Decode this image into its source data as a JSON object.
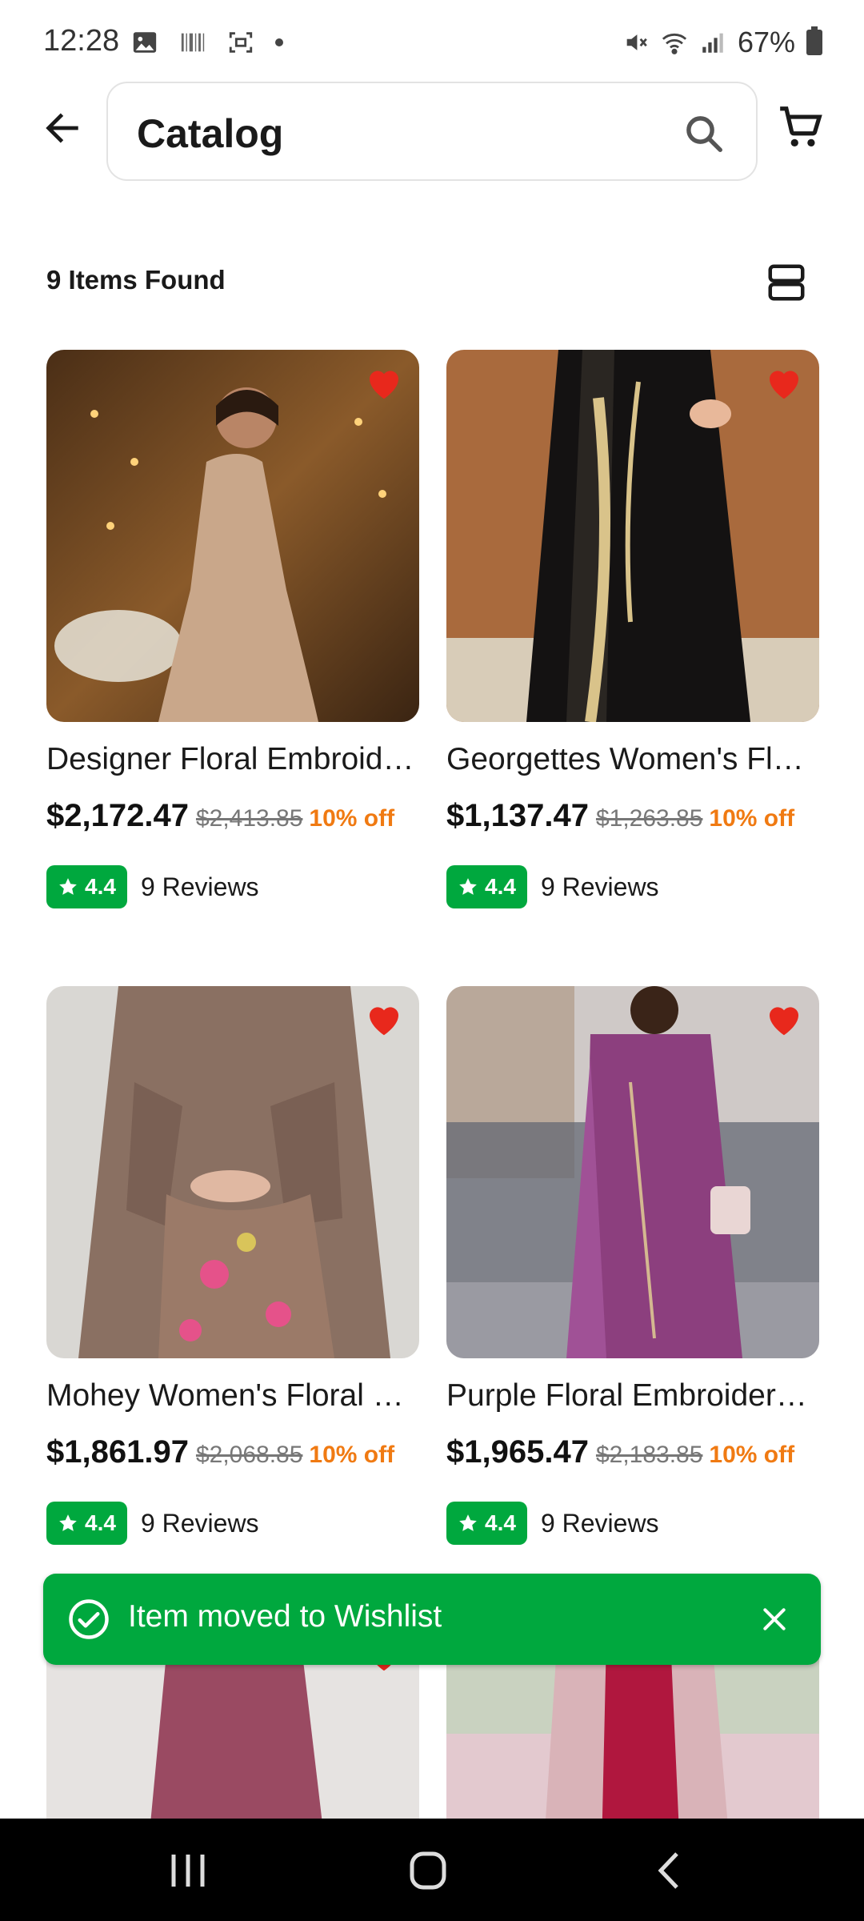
{
  "status_bar": {
    "time": "12:28",
    "battery": "67%",
    "icons": [
      "image-icon",
      "barcode-icon",
      "screenshot-icon",
      "dot-icon",
      "mute-icon",
      "wifi-icon",
      "signal-icon",
      "battery-icon"
    ]
  },
  "header": {
    "title": "Catalog",
    "back_icon": "arrow-left-icon",
    "search_icon": "search-icon",
    "cart_icon": "cart-icon"
  },
  "results": {
    "count_text": "9 Items Found",
    "view_toggle_icon": "view-list-icon"
  },
  "products": [
    {
      "name": "Designer Floral Embroidered Outfit",
      "price": "$2,172.47",
      "old_price": "$2,413.85",
      "discount": "10% off",
      "rating": "4.4",
      "reviews": "9 Reviews",
      "wishlisted": true
    },
    {
      "name": "Georgettes Women's Floral Dress",
      "price": "$1,137.47",
      "old_price": "$1,263.85",
      "discount": "10% off",
      "rating": "4.4",
      "reviews": "9 Reviews",
      "wishlisted": true
    },
    {
      "name": "Mohey Women's Floral Kurta",
      "price": "$1,861.97",
      "old_price": "$2,068.85",
      "discount": "10% off",
      "rating": "4.4",
      "reviews": "9 Reviews",
      "wishlisted": true
    },
    {
      "name": "Purple Floral Embroidered Suit",
      "price": "$1,965.47",
      "old_price": "$2,183.85",
      "discount": "10% off",
      "rating": "4.4",
      "reviews": "9 Reviews",
      "wishlisted": true
    }
  ],
  "toast": {
    "message": "Item moved to Wishlist",
    "icon": "check-circle-icon",
    "close_icon": "close-icon"
  },
  "colors": {
    "accent_green": "#00a83e",
    "discount_orange": "#f07a12",
    "heart_red": "#e8281c"
  }
}
